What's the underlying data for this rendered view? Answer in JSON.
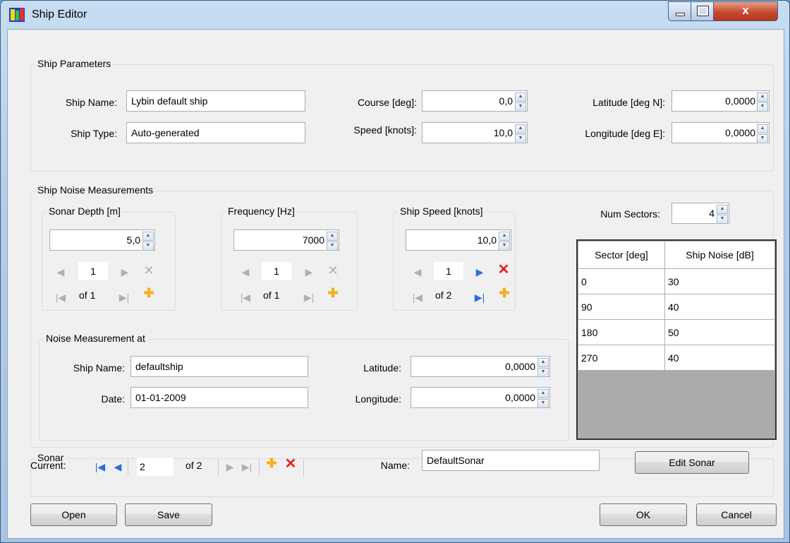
{
  "window": {
    "title": "Ship Editor",
    "app_icon": "ship-editor-icon"
  },
  "ship_parameters": {
    "legend": "Ship Parameters",
    "ship_name_label": "Ship Name:",
    "ship_name": "Lybin default ship",
    "ship_type_label": "Ship Type:",
    "ship_type": "Auto-generated",
    "course_label": "Course [deg]:",
    "course": "0,0",
    "speed_label": "Speed [knots]:",
    "speed": "10,0",
    "latitude_label": "Latitude [deg N]:",
    "latitude": "0,0000",
    "longitude_label": "Longitude [deg E]:",
    "longitude": "0,0000"
  },
  "noise": {
    "legend": "Ship Noise Measurements",
    "sonar_depth": {
      "legend": "Sonar Depth [m]",
      "value": "5,0",
      "index": "1",
      "of": "of 1"
    },
    "frequency": {
      "legend": "Frequency [Hz]",
      "value": "7000",
      "index": "1",
      "of": "of 1"
    },
    "ship_speed": {
      "legend": "Ship Speed [knots]",
      "value": "10,0",
      "index": "1",
      "of": "of 2"
    },
    "num_sectors_label": "Num Sectors:",
    "num_sectors": "4",
    "table": {
      "headers": [
        "Sector [deg]",
        "Ship Noise [dB]"
      ],
      "rows": [
        [
          "0",
          "30"
        ],
        [
          "90",
          "40"
        ],
        [
          "180",
          "50"
        ],
        [
          "270",
          "40"
        ]
      ]
    },
    "measurement": {
      "legend": "Noise Measurement at",
      "ship_name_label": "Ship Name:",
      "ship_name": "defaultship",
      "date_label": "Date:",
      "date": "01-01-2009",
      "latitude_label": "Latitude:",
      "latitude": "0,0000",
      "longitude_label": "Longitude:",
      "longitude": "0,0000"
    }
  },
  "sonar": {
    "legend": "Sonar",
    "current_label": "Current:",
    "current": "2",
    "of": "of 2",
    "name_label": "Name:",
    "name": "DefaultSonar",
    "edit_button": "Edit Sonar"
  },
  "buttons": {
    "open": "Open",
    "save": "Save",
    "ok": "OK",
    "cancel": "Cancel"
  }
}
